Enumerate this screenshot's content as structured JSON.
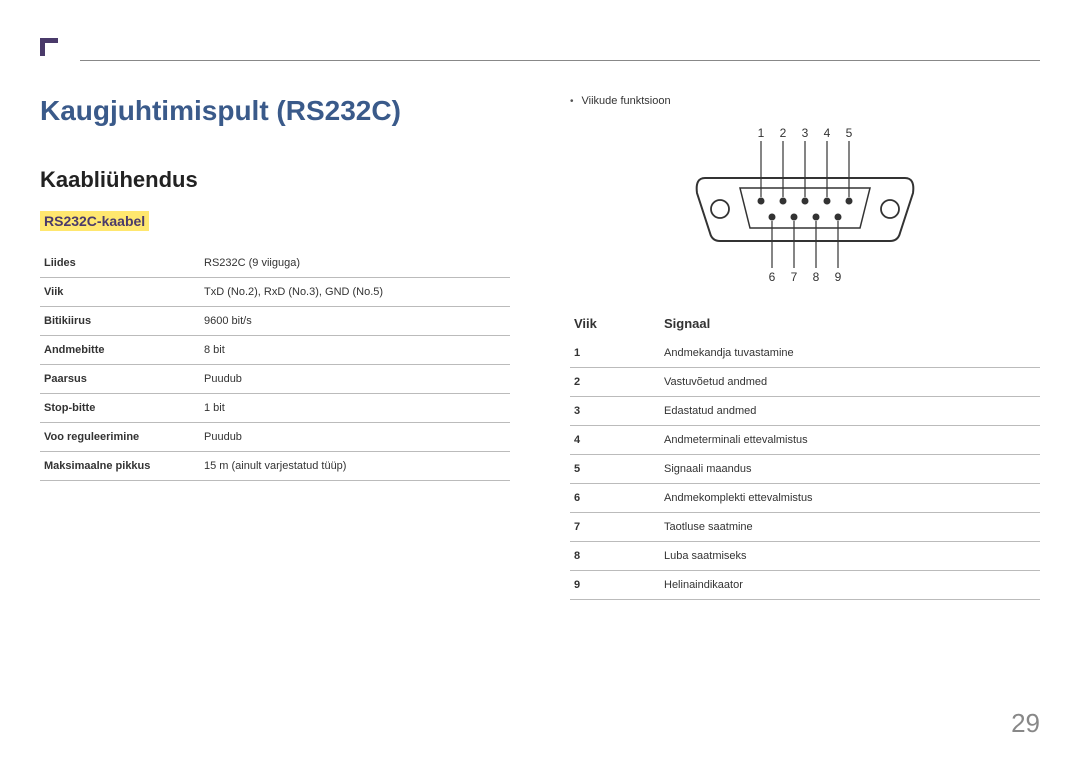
{
  "page_number": "29",
  "h1": "Kaugjuhtimispult (RS232C)",
  "h2": "Kaabliühendus",
  "h3": "RS232C-kaabel",
  "spec_rows": [
    {
      "label": "Liides",
      "value": "RS232C (9 viiguga)"
    },
    {
      "label": "Viik",
      "value": "TxD (No.2), RxD (No.3), GND (No.5)"
    },
    {
      "label": "Bitikiirus",
      "value": "9600 bit/s"
    },
    {
      "label": "Andmebitte",
      "value": "8 bit"
    },
    {
      "label": "Paarsus",
      "value": "Puudub"
    },
    {
      "label": "Stop-bitte",
      "value": "1 bit"
    },
    {
      "label": "Voo reguleerimine",
      "value": "Puudub"
    },
    {
      "label": "Maksimaalne pikkus",
      "value": "15 m (ainult varjestatud tüüp)"
    }
  ],
  "bullet": "Viikude funktsioon",
  "pin_labels_top": [
    "1",
    "2",
    "3",
    "4",
    "5"
  ],
  "pin_labels_bottom": [
    "6",
    "7",
    "8",
    "9"
  ],
  "sig_headers": {
    "pin": "Viik",
    "signal": "Signaal"
  },
  "signals": [
    {
      "pin": "1",
      "name": "Andmekandja tuvastamine"
    },
    {
      "pin": "2",
      "name": "Vastuvõetud andmed"
    },
    {
      "pin": "3",
      "name": "Edastatud andmed"
    },
    {
      "pin": "4",
      "name": "Andmeterminali ettevalmistus"
    },
    {
      "pin": "5",
      "name": "Signaali maandus"
    },
    {
      "pin": "6",
      "name": "Andmekomplekti ettevalmistus"
    },
    {
      "pin": "7",
      "name": "Taotluse saatmine"
    },
    {
      "pin": "8",
      "name": "Luba saatmiseks"
    },
    {
      "pin": "9",
      "name": "Helinaindikaator"
    }
  ]
}
